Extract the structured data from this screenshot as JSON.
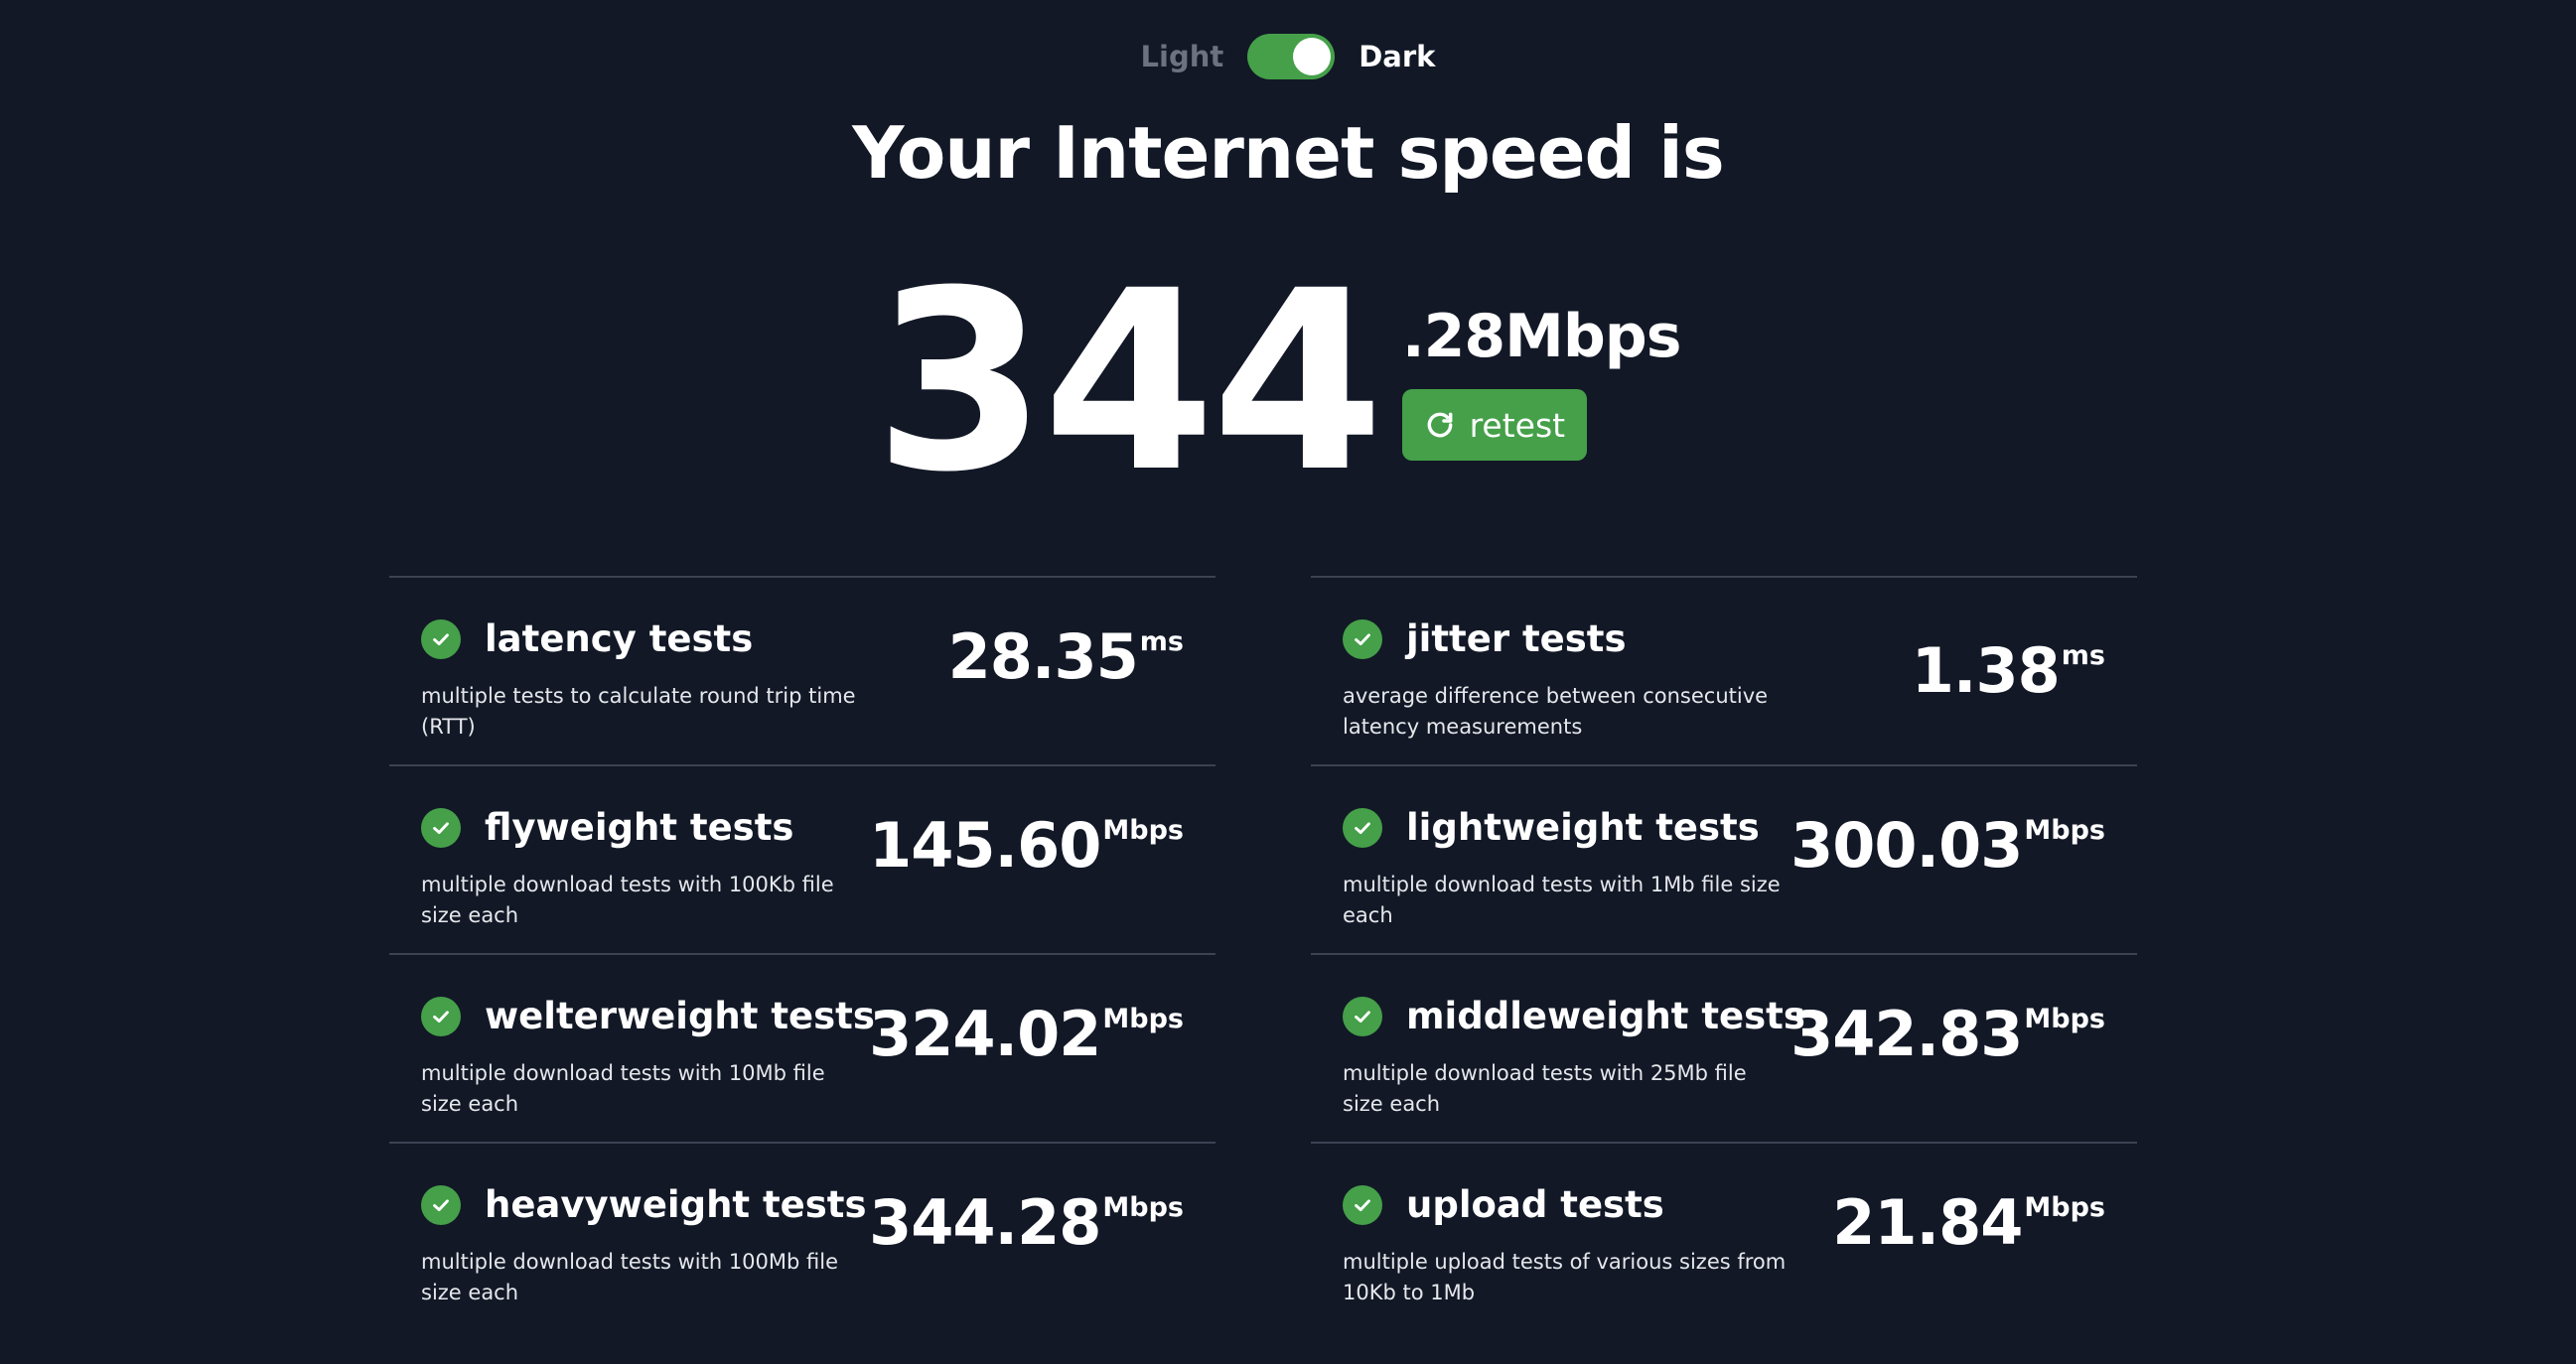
{
  "theme_toggle": {
    "light_label": "Light",
    "dark_label": "Dark",
    "selected": "Dark"
  },
  "headline": "Your Internet speed is",
  "speed": {
    "integer": "344",
    "fraction_unit": ".28Mbps",
    "retest_label": "retest"
  },
  "colors": {
    "background": "#121826",
    "accent": "#45a049",
    "divider": "#3b4252"
  },
  "results": [
    {
      "title": "latency tests",
      "description": "multiple tests to calculate round trip time (RTT)",
      "value": "28.35",
      "unit": "ms",
      "status_icon": "check-icon"
    },
    {
      "title": "jitter tests",
      "description": "average difference between consecutive latency measurements",
      "value": "1.38",
      "unit": "ms",
      "status_icon": "check-icon"
    },
    {
      "title": "flyweight tests",
      "description": "multiple download tests with 100Kb file size each",
      "value": "145.60",
      "unit": "Mbps",
      "status_icon": "check-icon"
    },
    {
      "title": "lightweight tests",
      "description": "multiple download tests with 1Mb file size each",
      "value": "300.03",
      "unit": "Mbps",
      "status_icon": "check-icon"
    },
    {
      "title": "welterweight tests",
      "description": "multiple download tests with 10Mb file size each",
      "value": "324.02",
      "unit": "Mbps",
      "status_icon": "check-icon"
    },
    {
      "title": "middleweight tests",
      "description": "multiple download tests with 25Mb file size each",
      "value": "342.83",
      "unit": "Mbps",
      "status_icon": "check-icon"
    },
    {
      "title": "heavyweight tests",
      "description": "multiple download tests with 100Mb file size each",
      "value": "344.28",
      "unit": "Mbps",
      "status_icon": "check-icon"
    },
    {
      "title": "upload tests",
      "description": "multiple upload tests of various sizes from 10Kb to 1Mb",
      "value": "21.84",
      "unit": "Mbps",
      "status_icon": "check-icon"
    }
  ]
}
